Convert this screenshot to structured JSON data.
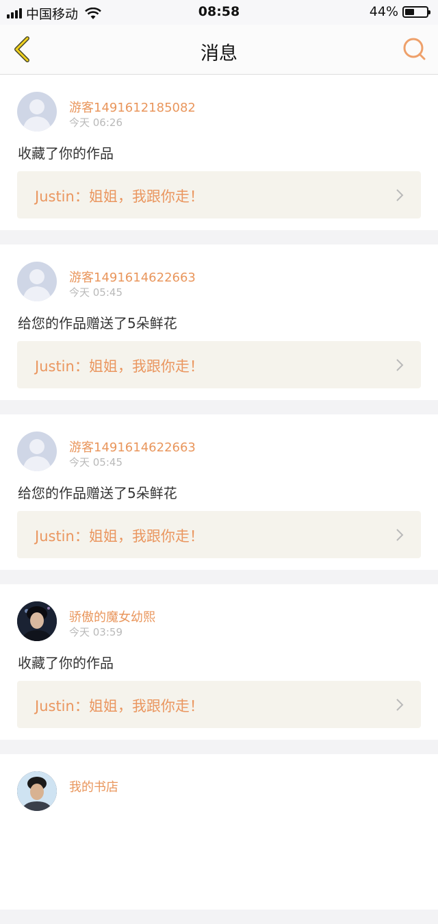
{
  "status_bar": {
    "carrier": "中国移动",
    "time": "08:58",
    "battery": "44%",
    "battery_level": 0.44
  },
  "nav": {
    "title": "消息",
    "back_icon": "chevron-left-icon",
    "search_icon": "search-icon"
  },
  "colors": {
    "accent": "#ea965f",
    "back_icon": "#e6c400"
  },
  "messages": [
    {
      "user": "游客1491612185082",
      "time": "今天 06:26",
      "action": "收藏了你的作品",
      "quote": "Justin：姐姐，我跟你走！"
    },
    {
      "user": "游客1491614622663",
      "time": "今天 05:45",
      "action": "给您的作品赠送了5朵鲜花",
      "quote": "Justin：姐姐，我跟你走！"
    },
    {
      "user": "游客1491614622663",
      "time": "今天 05:45",
      "action": "给您的作品赠送了5朵鲜花",
      "quote": "Justin：姐姐，我跟你走！"
    },
    {
      "user": "骄傲的魔女幼熙",
      "time": "今天 03:59",
      "action": "收藏了你的作品",
      "quote": "Justin：姐姐，我跟你走！"
    },
    {
      "user": "我的书店",
      "time": "",
      "action": "",
      "quote": ""
    }
  ]
}
